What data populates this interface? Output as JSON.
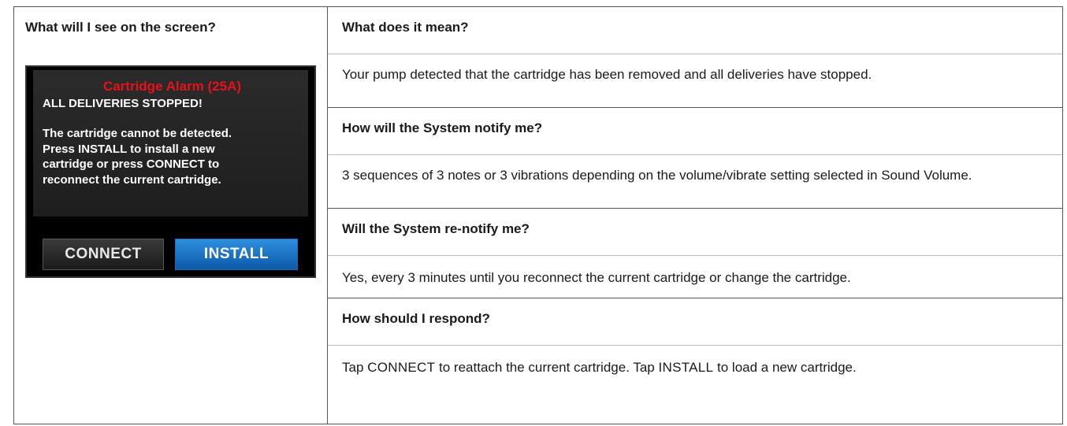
{
  "left": {
    "header": "What will I see on the screen?",
    "screen": {
      "alarm_title": "Cartridge Alarm (25A)",
      "subtitle": "ALL DELIVERIES STOPPED!",
      "message": "The cartridge cannot be detected.\nPress INSTALL to install a new\ncartridge or press CONNECT to\nreconnect the current cartridge.",
      "connect_label": "CONNECT",
      "install_label": "INSTALL"
    }
  },
  "right": {
    "sections": [
      {
        "question": "What does it mean?",
        "answer": "Your pump detected that the cartridge has been removed and all deliveries have stopped."
      },
      {
        "question": "How will the System notify me?",
        "answer": "3 sequences of 3 notes or 3 vibrations depending on the volume/vibrate setting selected in Sound Volume."
      },
      {
        "question": "Will the System re-notify me?",
        "answer": "Yes, every 3 minutes until you reconnect the current cartridge or change the cartridge."
      },
      {
        "question": "How should I respond?",
        "answer_parts": {
          "p1": "Tap ",
          "kw1": "CONNECT",
          "p2": " to reattach the current cartridge. Tap ",
          "kw2": "INSTALL",
          "p3": " to load a new cartridge."
        }
      }
    ]
  },
  "colors": {
    "alarm_red": "#e6121b",
    "install_blue": "#1b6cc0",
    "screen_black": "#000000"
  }
}
